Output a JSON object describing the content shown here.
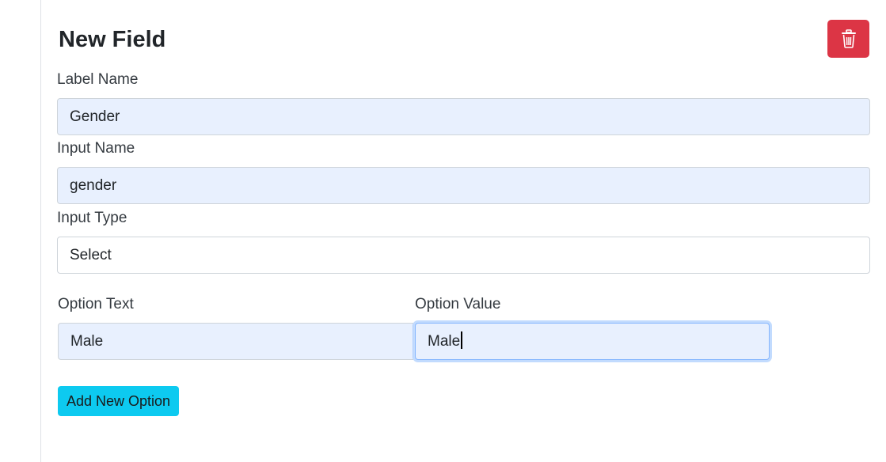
{
  "card": {
    "title": "New Field",
    "delete_icon": "trash-icon",
    "colors": {
      "delete": "#dc3545",
      "add_option": "#0dcaf0",
      "filled_input": "#e8f0fe",
      "focus_ring": "#86b7fe"
    }
  },
  "fields": {
    "label_name": {
      "label": "Label Name",
      "value": "Gender"
    },
    "input_name": {
      "label": "Input Name",
      "value": "gender"
    },
    "input_type": {
      "label": "Input Type",
      "value": "Select"
    }
  },
  "options": {
    "text_label": "Option Text",
    "value_label": "Option Value",
    "rows": [
      {
        "text": "Male",
        "value": "Male"
      }
    ],
    "add_label": "Add New Option"
  }
}
